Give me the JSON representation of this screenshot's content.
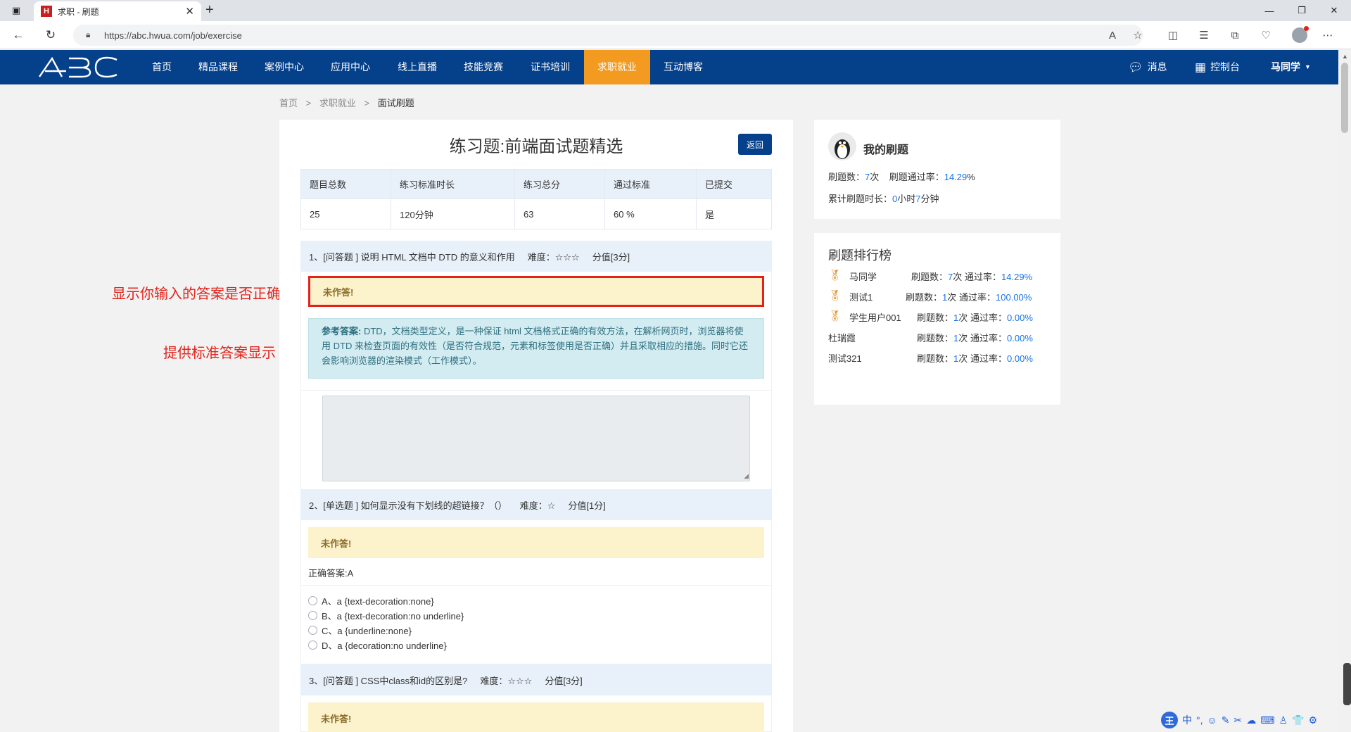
{
  "browser": {
    "tab_title": "求职 - 刷题",
    "tab_favicon": "H",
    "url": "https://abc.hwua.com/job/exercise"
  },
  "site": {
    "logo_text": "ABC",
    "nav": [
      "首页",
      "精品课程",
      "案例中心",
      "应用中心",
      "线上直播",
      "技能竞赛",
      "证书培训",
      "求职就业",
      "互动博客"
    ],
    "active_nav": "求职就业",
    "messages_label": "消息",
    "console_label": "控制台",
    "user_label": "马同学"
  },
  "breadcrumb": [
    "首页",
    ">",
    "求职就业",
    ">",
    "面试刷题"
  ],
  "exercise": {
    "title": "练习题:前端面试题精选",
    "back_label": "返回",
    "stats_headers": [
      "题目总数",
      "练习标准时长",
      "练习总分",
      "通过标准",
      "已提交"
    ],
    "stats_values": [
      "25",
      "120分钟",
      "63",
      "60 %",
      "是"
    ]
  },
  "questions": [
    {
      "header": "1、[问答题 ] 说明 HTML 文档中 DTD 的意义和作用",
      "difficulty": "难度：☆☆☆",
      "score": "分值[3分]",
      "status": "未作答!",
      "ref_label": "参考答案:",
      "ref_answer": " DTD，文档类型定义，是一种保证 html 文档格式正确的有效方法，在解析网页时，浏览器将使用 DTD 来检查页面的有效性（是否符合规范，元素和标签使用是否正确）并且采取相应的措施。同时它还会影响浏览器的渲染模式（工作模式）。"
    },
    {
      "header": "2、[单选题 ] 如何显示没有下划线的超链接？（）",
      "difficulty": "难度：☆",
      "score": "分值[1分]",
      "status": "未作答!",
      "correct": "正确答案:A",
      "options": [
        "A、a {text-decoration:none}",
        "B、a {text-decoration:no underline}",
        "C、a {underline:none}",
        "D、a {decoration:no underline}"
      ]
    },
    {
      "header": "3、[问答题 ] CSS中class和id的区别是?",
      "difficulty": "难度：☆☆☆",
      "score": "分值[3分]",
      "status": "未作答!"
    }
  ],
  "annotations": {
    "a1": "显示你输入的答案是否正确",
    "a2": "提供标准答案显示"
  },
  "my_practice": {
    "title": "我的刷题",
    "count_label": "刷题数：",
    "count_value": "7",
    "count_unit": "次",
    "rate_label": "刷题通过率：",
    "rate_value": "14.29",
    "rate_unit": "%",
    "time_label": "累计刷题时长：",
    "time_h": "0",
    "time_h_unit": "小时",
    "time_m": "7",
    "time_m_unit": "分钟"
  },
  "ranking": {
    "title": "刷题排行榜",
    "count_label": "刷题数：",
    "rate_label": "通过率：",
    "count_unit": "次",
    "pct": "%",
    "rows": [
      {
        "name": "马同学",
        "count": "7",
        "rate": "14.29",
        "medal": true
      },
      {
        "name": "测试1",
        "count": "1",
        "rate": "100.00",
        "medal": true
      },
      {
        "name": "学生用户001",
        "count": "1",
        "rate": "0.00",
        "medal": true
      },
      {
        "name": "杜瑞霞",
        "count": "1",
        "rate": "0.00",
        "medal": false
      },
      {
        "name": "测试321",
        "count": "1",
        "rate": "0.00",
        "medal": false
      }
    ]
  },
  "ime": {
    "logo": "王",
    "mode": "中",
    "items": [
      "°,",
      "☺",
      "✎",
      "✂",
      "☁",
      "⌨",
      "♙",
      "👕",
      "⚙"
    ]
  }
}
